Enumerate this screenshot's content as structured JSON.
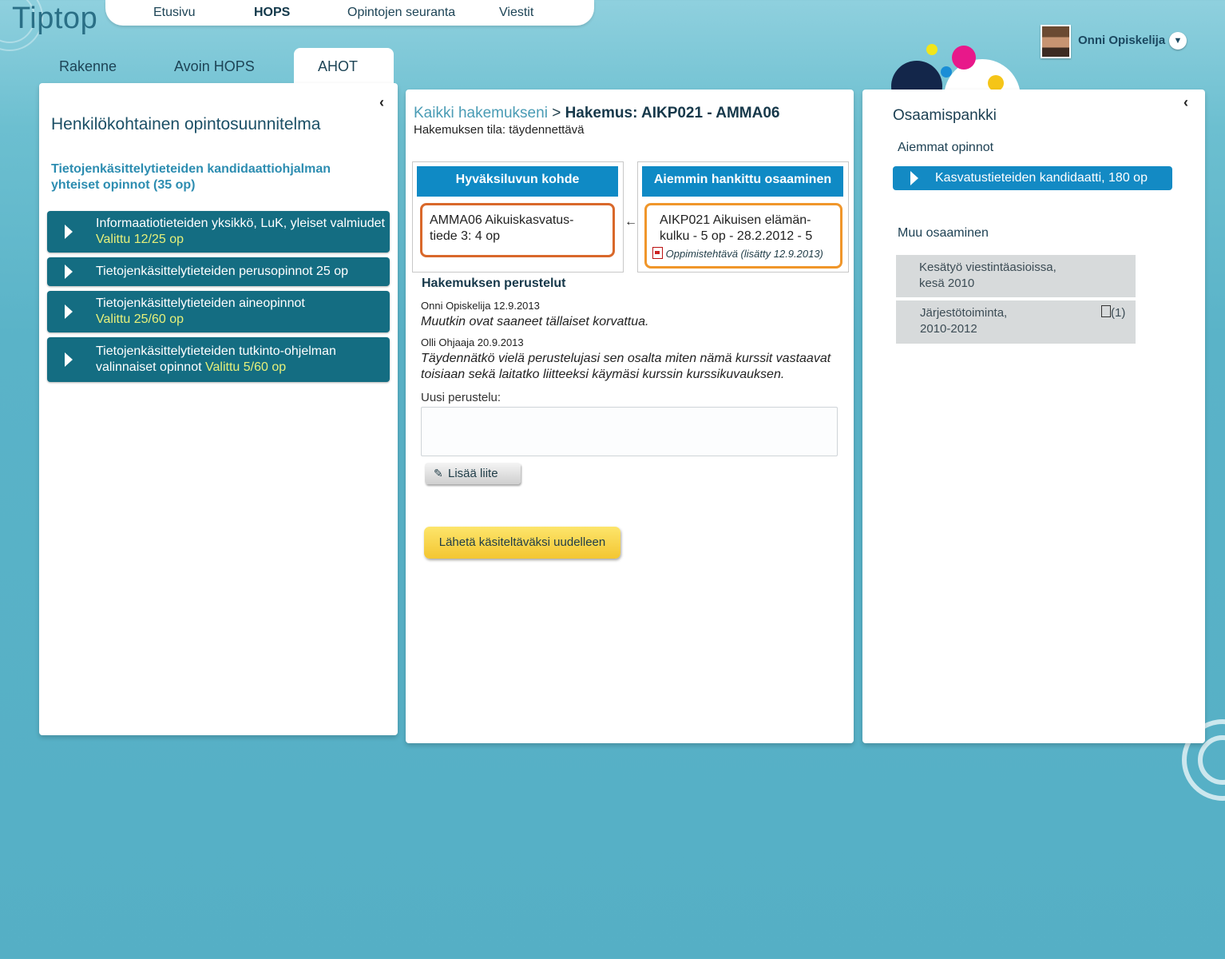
{
  "app": {
    "logo": "Tiptop"
  },
  "topnav": [
    "Etusivu",
    "HOPS",
    "Opintojen seuranta",
    "Viestit"
  ],
  "user": {
    "name": "Onni Opiskelija"
  },
  "subtabs": [
    "Rakenne",
    "Avoin HOPS",
    "AHOT"
  ],
  "left": {
    "title": "Henkilökohtainen opintosuunnitelma",
    "subtitle": "Tietojenkäsittelytieteiden kandidaattiohjalman yhteiset opinnot (35 op)",
    "courses": [
      {
        "name": "Informaatiotieteiden yksikkö, LuK, yleiset valmiudet",
        "status": "Valittu 12/25 op"
      },
      {
        "name": "Tietojenkäsittelytieteiden perusopinnot 25 op"
      },
      {
        "name": "Tietojenkäsittelytieteiden aineopinnot",
        "status": "Valittu 25/60 op"
      },
      {
        "name": "Tietojenkäsittelytieteiden tutkinto-ohjelman",
        "name2": "valinnaiset opinnot",
        "status": "Valittu 5/60 op"
      }
    ]
  },
  "center": {
    "breadcrumb_link": "Kaikki hakemukseni",
    "breadcrumb_sep": " > ",
    "breadcrumb_current": "Hakemus: AIKP021 - AMMA06",
    "state": "Hakemuksen tila: täydennettävä",
    "target_head": "Hyväksiluvun kohde",
    "target_line1": "AMMA06 Aikuiskasvatus-",
    "target_line2": "tiede 3: 4 op",
    "prior_head": "Aiemmin hankittu osaaminen",
    "prior_line1": "AIKP021 Aikuisen elämän-",
    "prior_line2": "kulku - 5 op - 28.2.2012 - 5",
    "prior_attachment": "Oppimistehtävä (lisätty 12.9.2013)",
    "arrow": "←",
    "justifications_title": "Hakemuksen perustelut",
    "comments": [
      {
        "author": "Onni Opiskelija 12.9.2013",
        "text": "Muutkin ovat saaneet tällaiset korvattua."
      },
      {
        "author": "Olli Ohjaaja 20.9.2013",
        "text": "Täydennätkö vielä perustelujasi sen osalta miten nämä kurssit vastaavat toisiaan sekä laitatko liitteeksi käymäsi kurssin kurssikuvauksen."
      }
    ],
    "new_label": "Uusi perustelu:",
    "new_value": "",
    "attach_button": "Lisää liite",
    "submit_button": "Lähetä käsiteltäväksi uudelleen"
  },
  "right": {
    "title": "Osaamispankki",
    "prior_studies_heading": "Aiemmat opinnot",
    "prior_study": "Kasvatustieteiden kandidaatti, 180 op",
    "other_heading": "Muu osaaminen",
    "other_items": [
      {
        "line1": "Kesätyö viestintäasioissa,",
        "line2": "kesä 2010"
      },
      {
        "line1": "Järjestötoiminta,",
        "line2": "2010-2012",
        "attachments": "(1)"
      }
    ]
  },
  "colors": {
    "course_bar": "#146d82",
    "accent_blue": "#0f8ac5",
    "target_border": "#d9682a",
    "prior_border": "#f0962a",
    "submit": "#f3c632"
  }
}
